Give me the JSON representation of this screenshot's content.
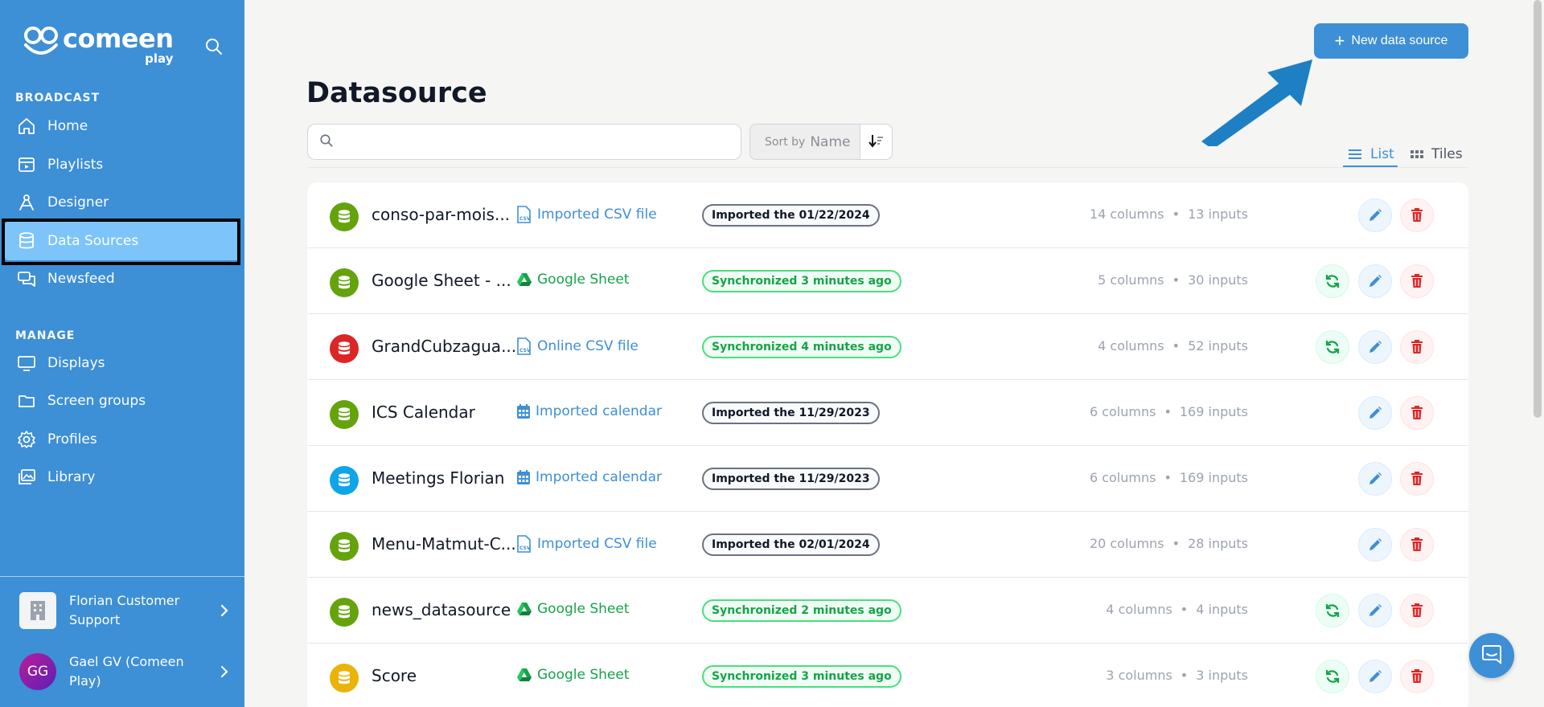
{
  "sidebar": {
    "logo_name": "comeen",
    "logo_sub": "play",
    "sections": {
      "broadcast": "BROADCAST",
      "manage": "MANAGE"
    },
    "items": [
      {
        "label": "Home",
        "icon": "home-icon"
      },
      {
        "label": "Playlists",
        "icon": "playlist-icon"
      },
      {
        "label": "Designer",
        "icon": "designer-icon"
      },
      {
        "label": "Data Sources",
        "icon": "database-icon",
        "active": true
      },
      {
        "label": "Newsfeed",
        "icon": "newsfeed-icon"
      },
      {
        "label": "Displays",
        "icon": "display-icon"
      },
      {
        "label": "Screen groups",
        "icon": "folder-icon"
      },
      {
        "label": "Profiles",
        "icon": "gear-icon"
      },
      {
        "label": "Library",
        "icon": "library-icon"
      }
    ],
    "org_name": "Florian Customer Support",
    "user_initials": "GG",
    "user_name": "Gael GV (Comeen Play)"
  },
  "header": {
    "new_button": "New data source",
    "title": "Datasource"
  },
  "toolbar": {
    "search_placeholder": "",
    "sort_label": "Sort by",
    "sort_value": "Name",
    "view_list": "List",
    "view_tiles": "Tiles"
  },
  "rows": [
    {
      "name": "conso-par-mois...",
      "icon_color": "#65a30d",
      "type": "Imported CSV file",
      "type_kind": "csv",
      "badge": "Imported the 01/22/2024",
      "badge_kind": "imp",
      "columns": "14 columns",
      "inputs": "13 inputs",
      "sync": false
    },
    {
      "name": "Google Sheet - ...",
      "icon_color": "#65a30d",
      "type": "Google Sheet",
      "type_kind": "gsheet",
      "badge": "Synchronized 3 minutes ago",
      "badge_kind": "sync",
      "columns": "5 columns",
      "inputs": "30 inputs",
      "sync": true
    },
    {
      "name": "GrandCubzagua...",
      "icon_color": "#dc2626",
      "type": "Online CSV file",
      "type_kind": "csv",
      "badge": "Synchronized 4 minutes ago",
      "badge_kind": "sync",
      "columns": "4 columns",
      "inputs": "52 inputs",
      "sync": true
    },
    {
      "name": "ICS Calendar",
      "icon_color": "#65a30d",
      "type": "Imported calendar",
      "type_kind": "cal",
      "badge": "Imported the 11/29/2023",
      "badge_kind": "imp",
      "columns": "6 columns",
      "inputs": "169 inputs",
      "sync": false
    },
    {
      "name": "Meetings Florian",
      "icon_color": "#0ea5e9",
      "type": "Imported calendar",
      "type_kind": "cal",
      "badge": "Imported the 11/29/2023",
      "badge_kind": "imp",
      "columns": "6 columns",
      "inputs": "169 inputs",
      "sync": false
    },
    {
      "name": "Menu-Matmut-C...",
      "icon_color": "#65a30d",
      "type": "Imported CSV file",
      "type_kind": "csv",
      "badge": "Imported the 02/01/2024",
      "badge_kind": "imp",
      "columns": "20 columns",
      "inputs": "28 inputs",
      "sync": false
    },
    {
      "name": "news_datasource",
      "icon_color": "#65a30d",
      "type": "Google Sheet",
      "type_kind": "gsheet",
      "badge": "Synchronized 2 minutes ago",
      "badge_kind": "sync",
      "columns": "4 columns",
      "inputs": "4 inputs",
      "sync": true
    },
    {
      "name": "Score",
      "icon_color": "#eab308",
      "type": "Google Sheet",
      "type_kind": "gsheet",
      "badge": "Synchronized 3 minutes ago",
      "badge_kind": "sync",
      "columns": "3 columns",
      "inputs": "3 inputs",
      "sync": true
    }
  ],
  "colors": {
    "brand": "#3d8fd6",
    "active_nav": "#7cc4fa",
    "delete": "#dc2626",
    "sync": "#16a34a"
  }
}
